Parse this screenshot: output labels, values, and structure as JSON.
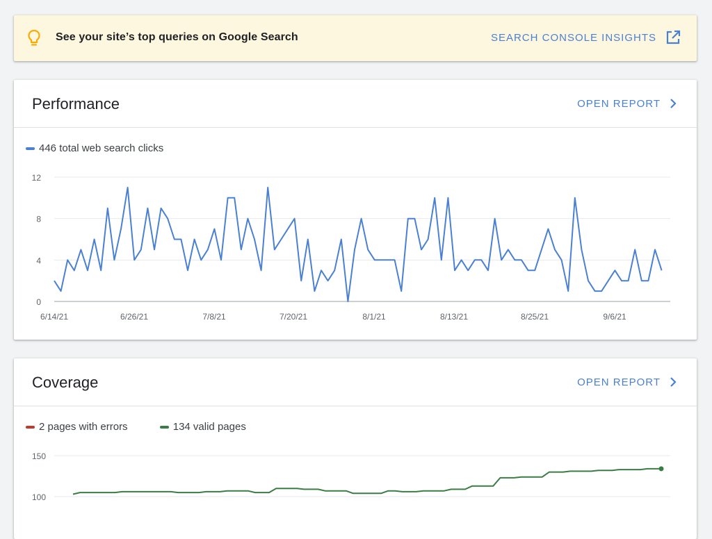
{
  "insights_banner": {
    "text": "See your site’s top queries on Google Search",
    "link_label": "SEARCH CONSOLE INSIGHTS",
    "icons": [
      "lightbulb-icon",
      "open-in-new-icon"
    ],
    "background_color": "#fef7e0",
    "icon_color": "#f9ab00"
  },
  "performance": {
    "title": "Performance",
    "open_label": "OPEN REPORT",
    "legend": [
      {
        "label": "446 total web search clicks",
        "color": "#4a80d4"
      }
    ]
  },
  "coverage": {
    "title": "Coverage",
    "open_label": "OPEN REPORT",
    "legend": [
      {
        "label": "2 pages with errors",
        "color": "#c0392b"
      },
      {
        "label": "134 valid pages",
        "color": "#3a7d44"
      }
    ]
  },
  "accent_color": "#4a80d4",
  "chart_data": [
    {
      "type": "line",
      "title": "",
      "xlabel": "",
      "ylabel": "",
      "x_tick_labels": [
        "6/14/21",
        "6/26/21",
        "7/8/21",
        "7/20/21",
        "8/1/21",
        "8/13/21",
        "8/25/21",
        "9/6/21"
      ],
      "y_ticks": [
        0,
        4,
        8,
        12
      ],
      "ylim": [
        0,
        12
      ],
      "grid": true,
      "x_start": "6/14/21",
      "x_end": "9/15/21",
      "series": [
        {
          "name": "446 total web search clicks",
          "color": "#4a80d4",
          "values": [
            2,
            1,
            4,
            3,
            5,
            3,
            6,
            3,
            9,
            4,
            7,
            11,
            4,
            5,
            9,
            5,
            9,
            8,
            6,
            6,
            3,
            6,
            4,
            5,
            7,
            4,
            10,
            10,
            5,
            8,
            6,
            3,
            11,
            5,
            6,
            7,
            8,
            2,
            6,
            1,
            3,
            2,
            3,
            6,
            0,
            5,
            8,
            5,
            4,
            4,
            4,
            4,
            1,
            8,
            8,
            5,
            6,
            10,
            4,
            10,
            3,
            4,
            3,
            4,
            4,
            3,
            8,
            4,
            5,
            4,
            4,
            3,
            3,
            5,
            7,
            5,
            4,
            1,
            10,
            5,
            2,
            1,
            1,
            2,
            3,
            2,
            2,
            5,
            2,
            2,
            5,
            3
          ]
        }
      ]
    },
    {
      "type": "line",
      "title": "",
      "xlabel": "",
      "ylabel": "",
      "y_ticks": [
        100,
        150
      ],
      "ylim": [
        50,
        150
      ],
      "grid": true,
      "series": [
        {
          "name": "134 valid pages",
          "color": "#3a7d44",
          "values": [
            103,
            105,
            105,
            105,
            105,
            105,
            105,
            106,
            106,
            106,
            106,
            106,
            106,
            106,
            106,
            105,
            105,
            105,
            105,
            106,
            106,
            106,
            107,
            107,
            107,
            107,
            105,
            105,
            105,
            110,
            110,
            110,
            110,
            109,
            109,
            109,
            107,
            107,
            107,
            107,
            104,
            104,
            104,
            104,
            104,
            107,
            107,
            106,
            106,
            106,
            107,
            107,
            107,
            107,
            109,
            109,
            109,
            113,
            113,
            113,
            113,
            123,
            123,
            123,
            124,
            124,
            124,
            124,
            130,
            130,
            130,
            131,
            131,
            131,
            131,
            132,
            132,
            132,
            133,
            133,
            133,
            133,
            134,
            134,
            134
          ]
        }
      ]
    }
  ]
}
